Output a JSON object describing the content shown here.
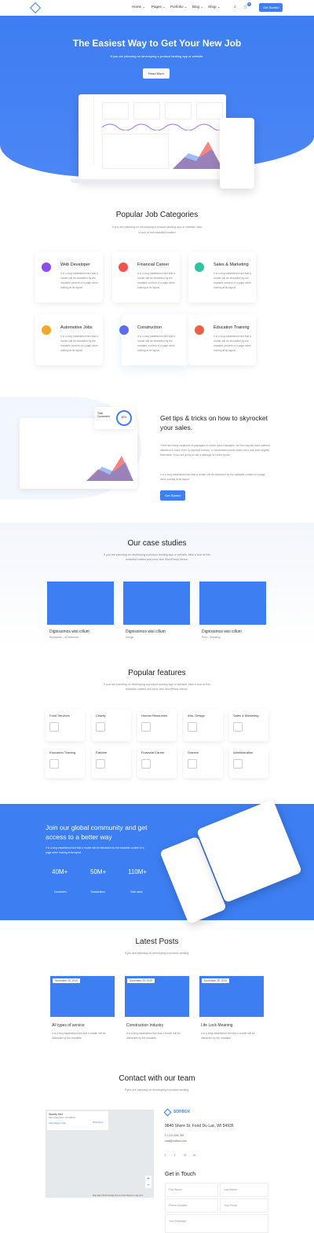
{
  "nav": {
    "menu": [
      "Home ⌄",
      "Pages ⌄",
      "Portfolio ⌄",
      "Blog ⌄",
      "Shop ⌄"
    ],
    "cart_count": "0",
    "get_started": "Get Started"
  },
  "hero": {
    "title": "The Easiest Way to Get Your New Job",
    "subtitle": "If you are planning on developing a product landing app or website.",
    "read_more": "Read More"
  },
  "categories": {
    "title": "Popular Job Categories",
    "subtitle_1": "If you are planning on developing a product landing app or website, take",
    "subtitle_2": "a look at this beautiful-crafted",
    "items": [
      {
        "title": "Web Developer",
        "color": "#8a4cf0",
        "text": "It is a long established fact that a reader will be distracted by the readable content of a page when looking at its layout."
      },
      {
        "title": "Financial Career",
        "color": "#f0534c",
        "text": "It is a long established fact that a reader will be distracted by the readable content of a page when looking at its layout."
      },
      {
        "title": "Sales & Marketing",
        "color": "#2ec4a0",
        "text": "It is a long established fact that a reader will be distracted by the readable content of a page when looking at its layout."
      },
      {
        "title": "Automotive Jobs",
        "color": "#f5a623",
        "text": "It is a long established fact that a reader will be distracted by the readable content of a page when looking at its layout."
      },
      {
        "title": "Construction",
        "color": "#5c6bf0",
        "text": "It is a long established fact that a reader will be distracted by the readable content of a page when looking at its layout."
      },
      {
        "title": "Education Training",
        "color": "#f06040",
        "text": "It is a long established fact that a reader will be distracted by the readable content of a page when looking at its layout."
      }
    ]
  },
  "tips": {
    "title": "Get tips & tricks on how to skyrocket your sales.",
    "text_1": "There are many variations of passages of Lorem Ipsum available, but the majority have suffered alteration in some form, by injected humour, or randomised words which don't look even slightly believable. If you are going to use a passage of Lorem Ipsum.",
    "text_2": "It is a long established fact that a reader will be distracted by the readable content of a page when looking at its layout.",
    "button": "Get Started",
    "widget_label": "Total Customers",
    "widget_percent": "80%"
  },
  "cases": {
    "title": "Our case studies",
    "subtitle": "If you are planning on developing a product landing app or website, take a look at this beautiful-crafted and error-free WordPress theme.",
    "items": [
      {
        "title": "Dignissimos wisi cillum",
        "meta": "Wordpress – eCommerce"
      },
      {
        "title": "Dignissimos wisi cillum",
        "meta": "Design"
      },
      {
        "title": "Dignissimos wisi cillum",
        "meta": "Print – Branding"
      }
    ]
  },
  "features": {
    "title": "Popular features",
    "subtitle": "If you are planning on developing a product landing app or website, take a look at this beautiful-crafted and error-free WordPress theme.",
    "items": [
      "Food Services",
      "Charity",
      "Human Resources",
      "Arts, Design",
      "Sales & Marketing",
      "Education Training",
      "Fashion",
      "Financial Career",
      "Science",
      "Administration"
    ]
  },
  "community": {
    "title": "Join our global community and get access to a better way",
    "text": "It is a long established fact that a reader will be distracted by the readable content of a page when looking at its layout.",
    "stats": [
      {
        "value": "40M+",
        "label": "Customers"
      },
      {
        "value": "50M+",
        "label": "Transactions"
      },
      {
        "value": "110M+",
        "label": "Total value"
      }
    ]
  },
  "posts": {
    "title": "Latest Posts",
    "subtitle": "If you are planning on developing a product landing.",
    "items": [
      {
        "date": "November 25, 2019",
        "title": "All types of service",
        "text": "It is a long established fact that a reader will be distracted by the readable."
      },
      {
        "date": "November 25, 2019",
        "title": "Construction Industry",
        "text": "It is a long established fact that a reader will be distracted by the readable."
      },
      {
        "date": "November 25, 2019",
        "title": "Life Lock Meaning",
        "text": "It is a long established fact that a reader will be distracted by the readable."
      }
    ]
  },
  "contact": {
    "title": "Contact with our team",
    "subtitle": "If you are planning on developing a product landing.",
    "brand": "SOFBOX",
    "address": "9840 Shore St. Fond Du Lac, WI 54935",
    "phone": "0 1233 456 789",
    "email": "mail@sofbox.com",
    "map_name": "Stoney Hun",
    "map_city": "San Francisco, CA 94114",
    "map_larger": "View larger map",
    "map_directions": "Directions",
    "map_footer": "Map data ©2019 Google   Terms of Use   Report a map error",
    "get_in_touch": "Get in Touch",
    "fields": [
      "First Name",
      "Last Name",
      "Phone Number",
      "Your Email",
      "Your Message"
    ]
  }
}
